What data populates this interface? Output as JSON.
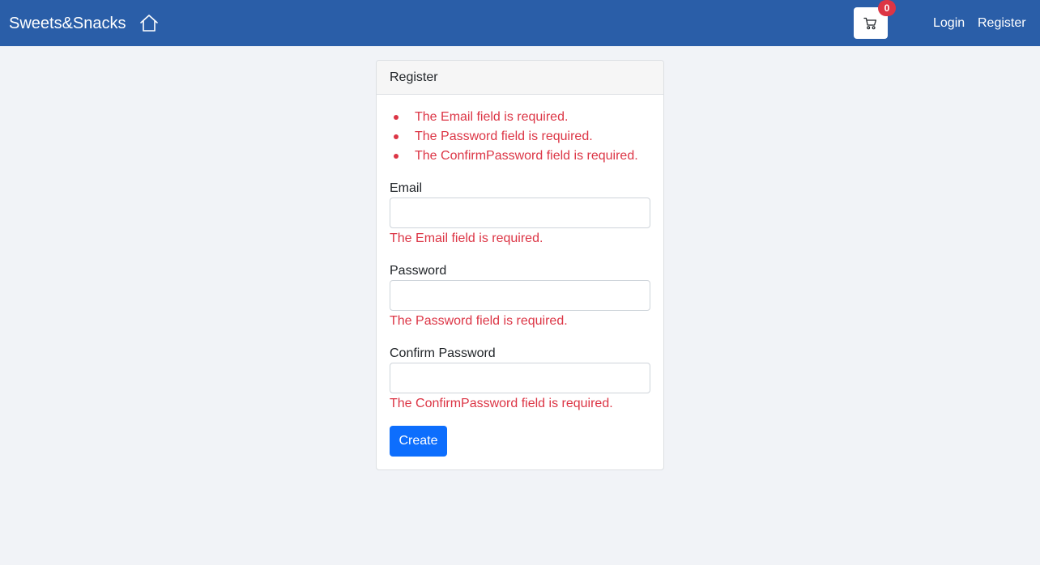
{
  "navbar": {
    "brand": "Sweets&Snacks",
    "home_icon": "home-icon",
    "cart_icon": "cart-icon",
    "cart_count": "0",
    "login": "Login",
    "register": "Register",
    "bg_color": "#2a5ea8"
  },
  "card": {
    "header": "Register",
    "summary_errors": [
      "The Email field is required.",
      "The Password field is required.",
      "The ConfirmPassword field is required."
    ],
    "fields": [
      {
        "label": "Email",
        "value": "",
        "error": "The Email field is required."
      },
      {
        "label": "Password",
        "value": "",
        "error": "The Password field is required."
      },
      {
        "label": "Confirm Password",
        "value": "",
        "error": "The ConfirmPassword field is required."
      }
    ],
    "submit": "Create",
    "error_color": "#dc3545",
    "button_color": "#0d6efd"
  }
}
